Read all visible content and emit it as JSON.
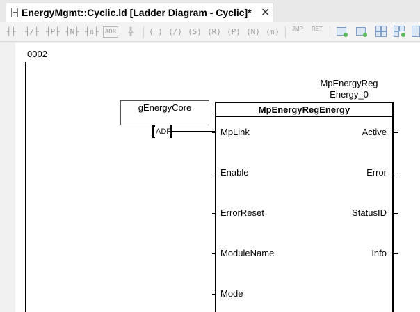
{
  "tab": {
    "title": "EnergyMgmt::Cyclic.ld [Ladder Diagram - Cyclic]*",
    "close": "✕"
  },
  "toolbar": {
    "items": [
      {
        "name": "contact-icon",
        "glyph": "┤├"
      },
      {
        "name": "negated-contact-icon",
        "glyph": "┤/├"
      },
      {
        "name": "positive-edge-contact-icon",
        "glyph": "┤P├"
      },
      {
        "name": "negative-edge-contact-icon",
        "glyph": "┤N├"
      },
      {
        "name": "edge-contact-icon",
        "glyph": "┤⇅├"
      },
      {
        "name": "address-icon",
        "glyph": "ADR"
      },
      {
        "name": "parallel-branch-icon",
        "glyph": "╬"
      },
      {
        "name": "coil-icon",
        "glyph": "( )"
      },
      {
        "name": "negated-coil-icon",
        "glyph": "(/)"
      },
      {
        "name": "set-coil-icon",
        "glyph": "(S)"
      },
      {
        "name": "reset-coil-icon",
        "glyph": "(R)"
      },
      {
        "name": "positive-transition-coil-icon",
        "glyph": "(P)"
      },
      {
        "name": "negative-transition-coil-icon",
        "glyph": "(N)"
      },
      {
        "name": "other-coil-icon",
        "glyph": "(⇅)"
      },
      {
        "name": "jump-icon",
        "glyph": "JMP"
      },
      {
        "name": "return-icon",
        "glyph": "RET"
      }
    ]
  },
  "editor": {
    "rung_number": "0002",
    "instance": {
      "line1": "MpEnergyReg",
      "line2": "Energy_0"
    },
    "block": {
      "title": "MpEnergyRegEnergy",
      "inputs": [
        "MpLink",
        "Enable",
        "ErrorReset",
        "ModuleName",
        "Mode"
      ],
      "outputs": [
        "Active",
        "Error",
        "StatusID",
        "Info"
      ]
    },
    "variable": "gEnergyCore",
    "adr_label": "ADR"
  }
}
